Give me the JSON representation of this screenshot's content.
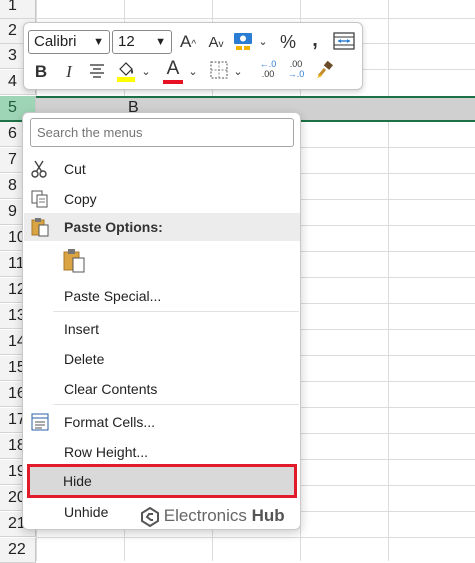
{
  "sheet": {
    "row_numbers": [
      "1",
      "2",
      "3",
      "4",
      "5",
      "6",
      "7",
      "8",
      "9",
      "10",
      "11",
      "12",
      "13",
      "14",
      "15",
      "16",
      "17",
      "18",
      "19",
      "20",
      "21",
      "22"
    ],
    "selected_row": "5",
    "cell_b5": "B"
  },
  "toolbar": {
    "font_name": "Calibri",
    "font_size": "12",
    "increase_font": "A",
    "decrease_font": "A",
    "percent": "%",
    "comma": ",",
    "bold": "B",
    "italic": "I",
    "font_color_letter": "A",
    "increase_decimal_top": "←.0",
    "increase_decimal_bottom": ".00",
    "decrease_decimal_top": ".00",
    "decrease_decimal_bottom": "→.0"
  },
  "menu": {
    "search_placeholder": "Search the menus",
    "items": {
      "cut": "Cut",
      "copy": "Copy",
      "paste_options": "Paste Options:",
      "paste_special": "Paste Special...",
      "insert": "Insert",
      "delete": "Delete",
      "clear_contents": "Clear Contents",
      "format_cells": "Format Cells...",
      "row_height": "Row Height...",
      "hide": "Hide",
      "unhide": "Unhide"
    }
  },
  "watermark": {
    "text_light": "Electronics ",
    "text_bold": "Hub"
  },
  "colors": {
    "accent_green": "#1e7145",
    "highlight_red": "#e21b2b",
    "font_color_red": "#e81123",
    "fill_yellow": "#ffff00"
  }
}
